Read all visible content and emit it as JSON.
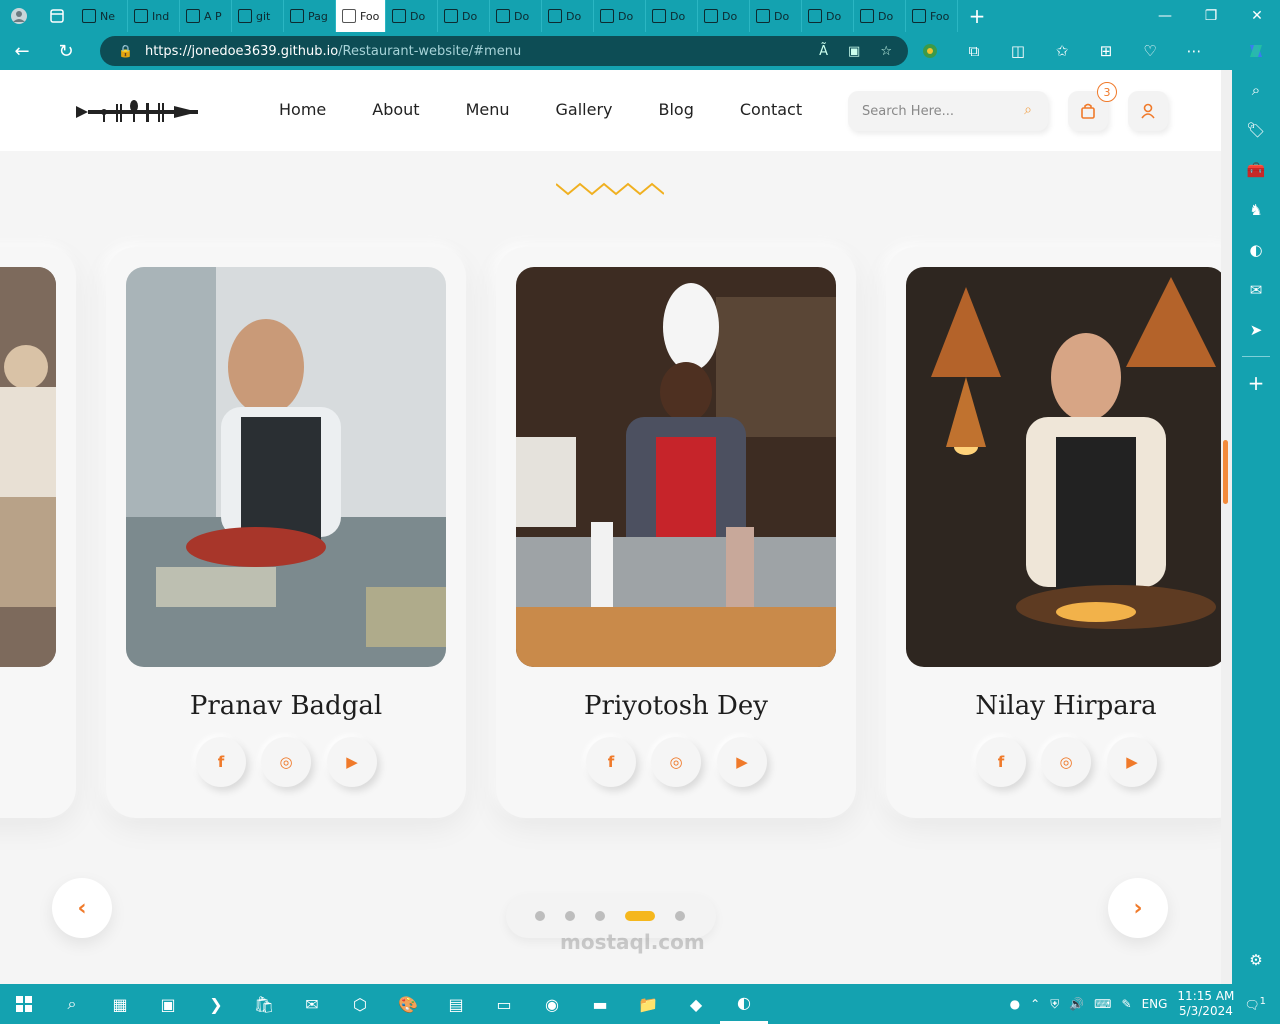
{
  "browser": {
    "tabs": [
      {
        "label": "Ne",
        "icon": "newsletter-icon"
      },
      {
        "label": "Ind",
        "icon": "site-icon"
      },
      {
        "label": "A P",
        "icon": "app-icon"
      },
      {
        "label": "git",
        "icon": "search-icon"
      },
      {
        "label": "Pag",
        "icon": "github-icon"
      },
      {
        "label": "Foo",
        "icon": "food-icon",
        "active": true
      },
      {
        "label": "Do",
        "icon": "document-icon"
      },
      {
        "label": "Do",
        "icon": "document-icon"
      },
      {
        "label": "Do",
        "icon": "document-icon"
      },
      {
        "label": "Do",
        "icon": "document-icon"
      },
      {
        "label": "Do",
        "icon": "document-icon"
      },
      {
        "label": "Do",
        "icon": "document-icon"
      },
      {
        "label": "Do",
        "icon": "document-icon"
      },
      {
        "label": "Do",
        "icon": "document-icon"
      },
      {
        "label": "Do",
        "icon": "document-icon"
      },
      {
        "label": "Do",
        "icon": "document-icon"
      },
      {
        "label": "Foo",
        "icon": "document-icon"
      }
    ],
    "url_host": "https://jonedoe3639.github.io",
    "url_path": "/Restaurant-website/#menu",
    "accent": "#14a2b0"
  },
  "site": {
    "nav": [
      "Home",
      "About",
      "Menu",
      "Gallery",
      "Blog",
      "Contact"
    ],
    "search_placeholder": "Search Here...",
    "cart_count": "3",
    "accent": "#f07a2a"
  },
  "chefs": [
    {
      "name": "Pranav Badgal"
    },
    {
      "name": "Priyotosh Dey"
    },
    {
      "name": "Nilay Hirpara"
    }
  ],
  "social_icons": [
    "facebook-icon",
    "instagram-icon",
    "youtube-icon"
  ],
  "slider": {
    "dot_count": 5,
    "active_dot": 4
  },
  "taskbar": {
    "language": "ENG",
    "time": "11:15 AM",
    "date": "5/3/2024",
    "notifications": "1",
    "watermark": "mostaql.com"
  }
}
